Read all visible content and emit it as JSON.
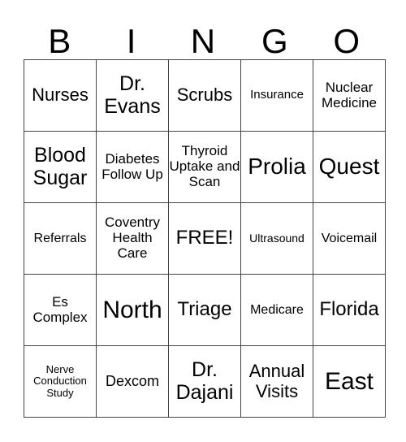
{
  "header": [
    "B",
    "I",
    "N",
    "G",
    "O"
  ],
  "rows": [
    [
      "Nurses",
      "Dr. Evans",
      "Scrubs",
      "Insurance",
      "Nuclear Medicine"
    ],
    [
      "Blood Sugar",
      "Diabetes Follow Up",
      "Thyroid Uptake and Scan",
      "Prolia",
      "Quest"
    ],
    [
      "Referrals",
      "Coventry Health Care",
      "FREE!",
      "Ultrasound",
      "Voicemail"
    ],
    [
      "Es Complex",
      "North",
      "Triage",
      "Medicare",
      "Florida"
    ],
    [
      "Nerve Conduction Study",
      "Dexcom",
      "Dr. Dajani",
      "Annual Visits",
      "East"
    ]
  ]
}
